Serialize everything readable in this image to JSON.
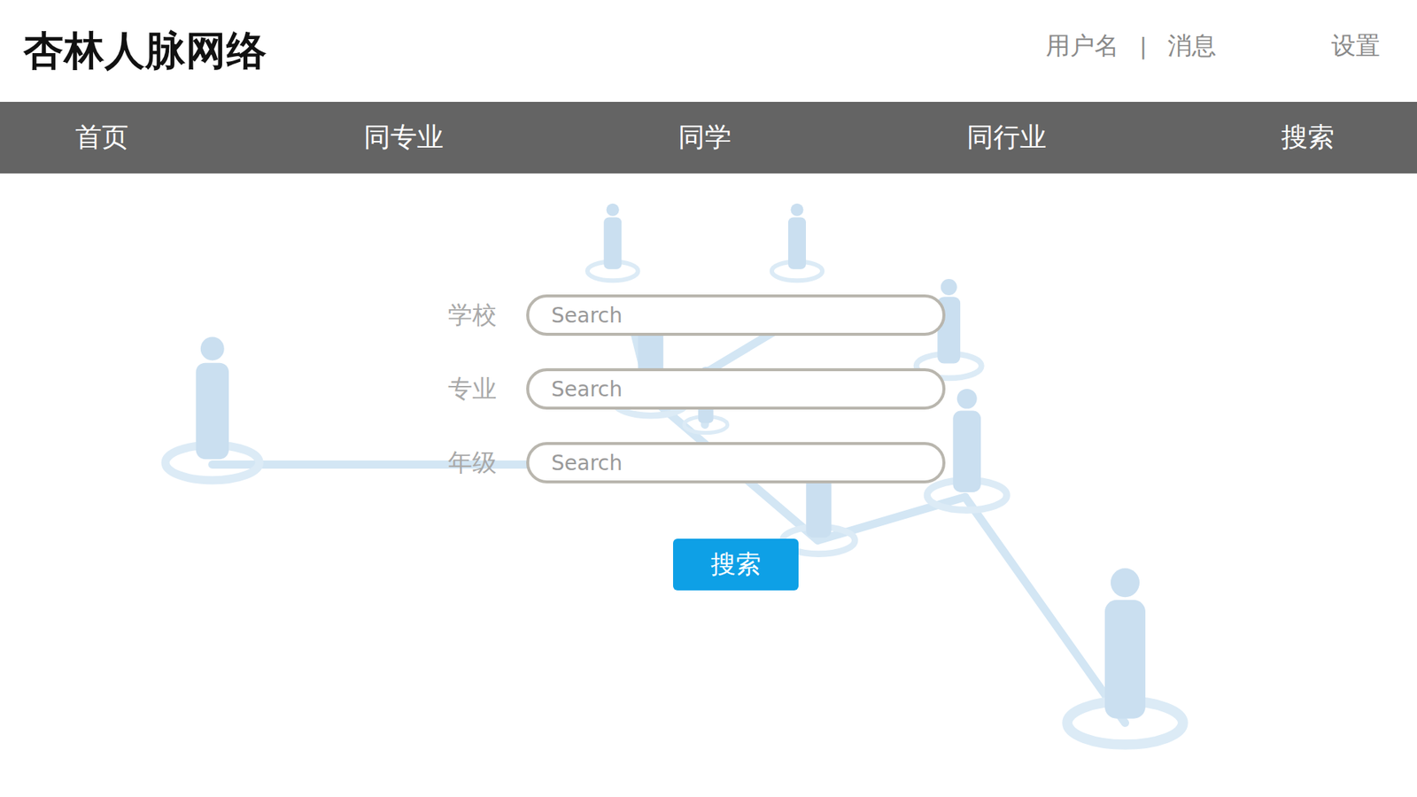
{
  "header": {
    "title": "杏林人脉网络",
    "user_name": "用户名",
    "separator": "|",
    "messages": "消息",
    "settings": "设置"
  },
  "nav": {
    "items": [
      {
        "label": "首页"
      },
      {
        "label": "同专业"
      },
      {
        "label": "同学"
      },
      {
        "label": "同行业"
      },
      {
        "label": "搜索"
      }
    ]
  },
  "search_form": {
    "fields": [
      {
        "label": "学校",
        "placeholder": "Search"
      },
      {
        "label": "专业",
        "placeholder": "Search"
      },
      {
        "label": "年级",
        "placeholder": "Search"
      }
    ],
    "button": "搜索"
  }
}
